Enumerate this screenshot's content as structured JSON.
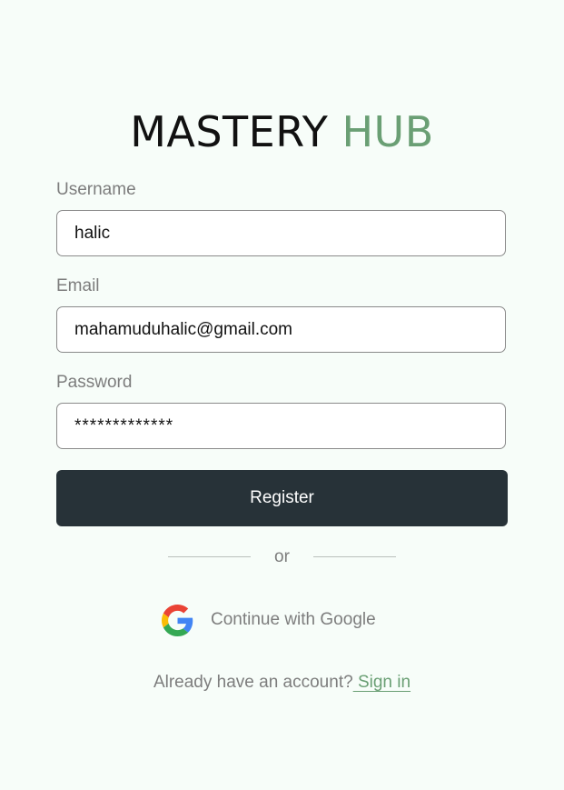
{
  "logo": {
    "word1": "MASTERY",
    "word2": "HUB"
  },
  "form": {
    "username_label": "Username",
    "username_value": "halic",
    "email_label": "Email",
    "email_value": "mahamuduhalic@gmail.com",
    "password_label": "Password",
    "password_value": "*************"
  },
  "register_label": "Register",
  "divider_text": "or",
  "google": {
    "label": "Continue with Google",
    "icon": "google-icon"
  },
  "footer": {
    "prompt": "Already have an account?",
    "link": " Sign in"
  },
  "colors": {
    "background": "#f7fdf9",
    "accent": "#6a9f74",
    "button": "#273238",
    "muted_text": "#7d7d7d"
  }
}
